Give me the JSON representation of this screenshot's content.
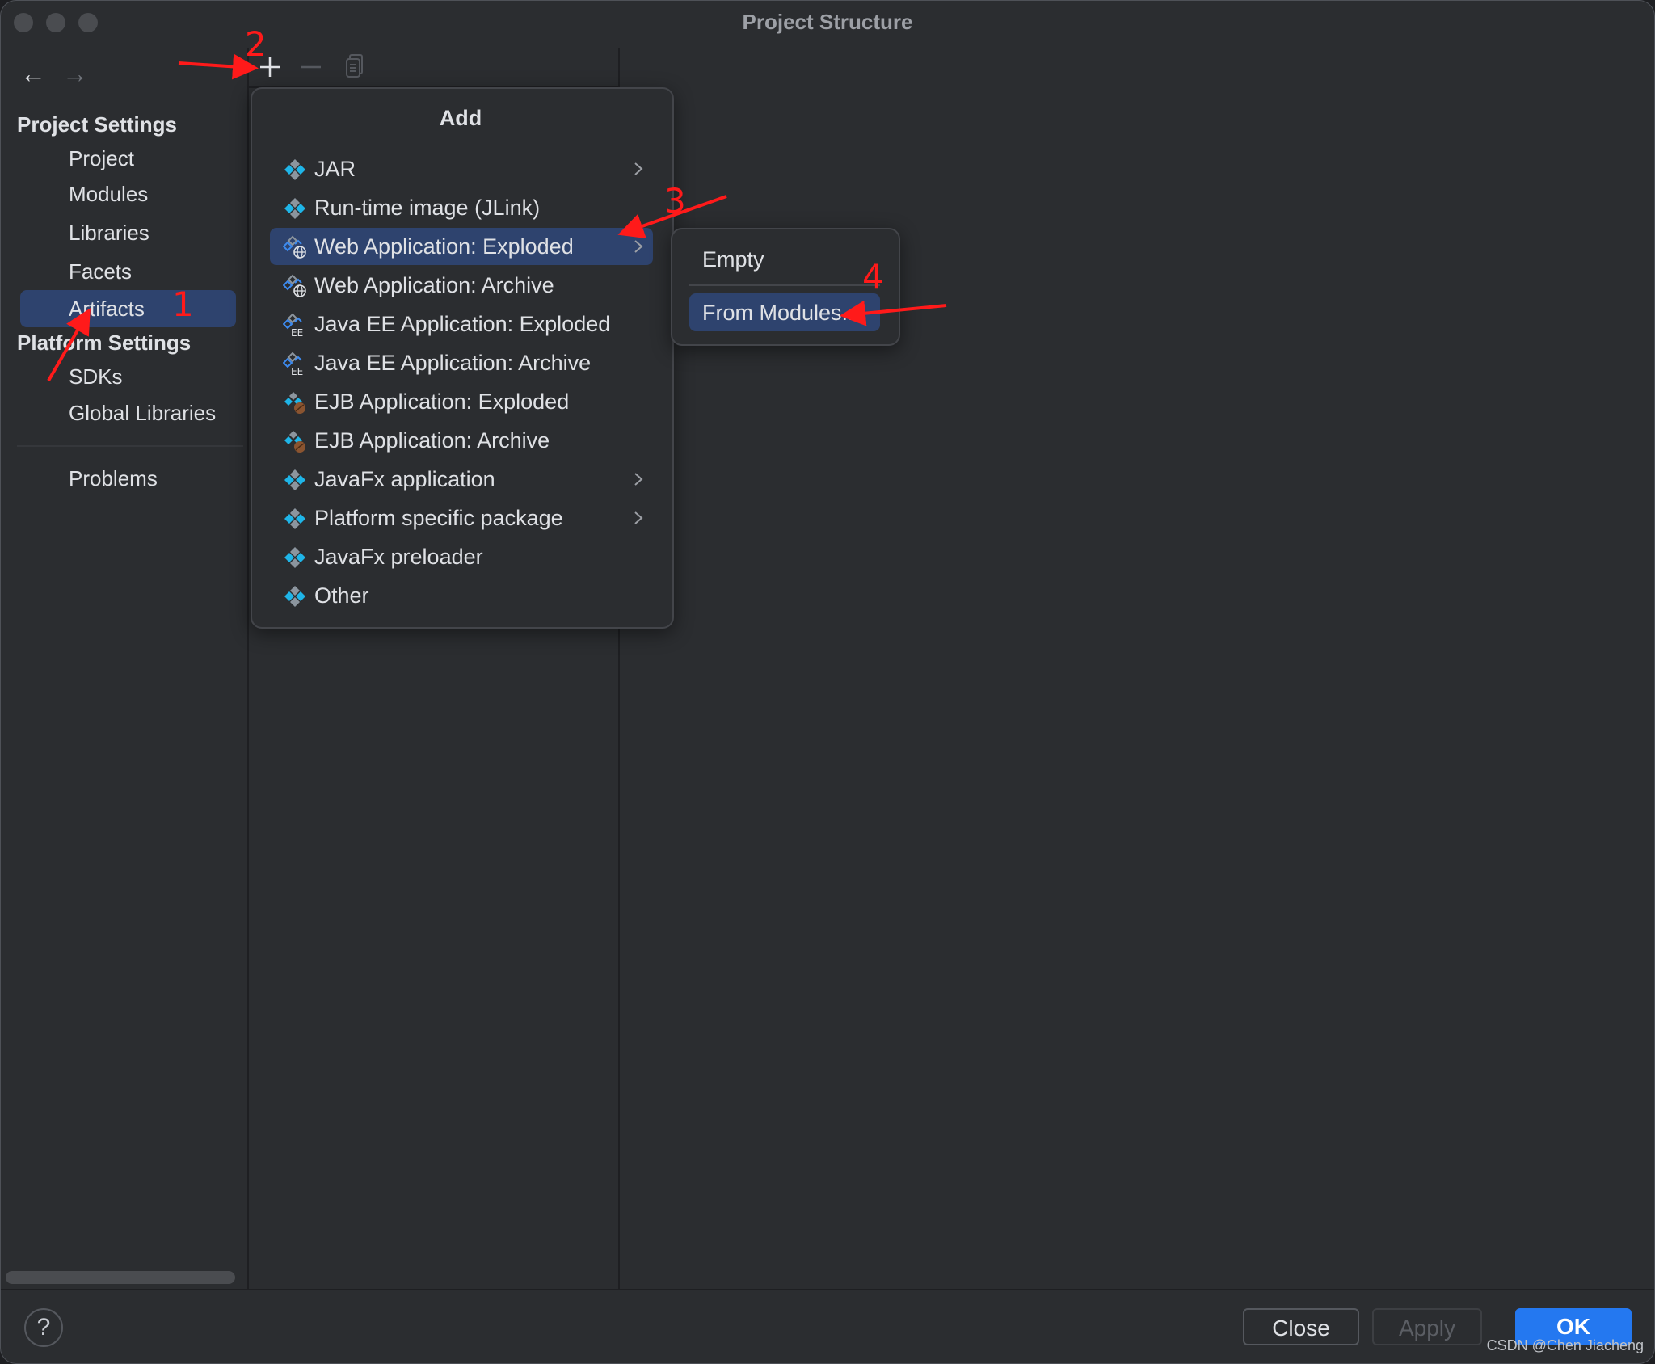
{
  "window": {
    "title": "Project Structure",
    "traffic_lights": [
      "close-button",
      "minimize-button",
      "zoom-button"
    ]
  },
  "nav": {
    "back_icon": "arrow-left-icon",
    "back_glyph": "←",
    "forward_icon": "arrow-right-icon",
    "forward_glyph": "→"
  },
  "toolbar": {
    "add_icon": "plus-icon",
    "remove_icon": "minus-icon",
    "copy_icon": "copy-icon"
  },
  "sidebar": {
    "project_settings_heading": "Project Settings",
    "project_settings_items": [
      {
        "label": "Project",
        "selected": false
      },
      {
        "label": "Modules",
        "selected": false
      },
      {
        "label": "Libraries",
        "selected": false
      },
      {
        "label": "Facets",
        "selected": false
      },
      {
        "label": "Artifacts",
        "selected": true
      }
    ],
    "platform_settings_heading": "Platform Settings",
    "platform_settings_items": [
      {
        "label": "SDKs"
      },
      {
        "label": "Global Libraries"
      }
    ],
    "problems_label": "Problems"
  },
  "add_menu": {
    "title": "Add",
    "items": [
      {
        "label": "JAR",
        "icon": "artifact-icon",
        "has_submenu": true,
        "highlighted": false
      },
      {
        "label": "Run-time image (JLink)",
        "icon": "artifact-icon",
        "has_submenu": false,
        "highlighted": false
      },
      {
        "label": "Web Application: Exploded",
        "icon": "web-artifact-icon",
        "has_submenu": true,
        "highlighted": true
      },
      {
        "label": "Web Application: Archive",
        "icon": "web-artifact-icon",
        "has_submenu": false,
        "highlighted": false
      },
      {
        "label": "Java EE Application: Exploded",
        "icon": "javaee-artifact-icon",
        "has_submenu": false,
        "highlighted": false
      },
      {
        "label": "Java EE Application: Archive",
        "icon": "javaee-artifact-icon",
        "has_submenu": false,
        "highlighted": false
      },
      {
        "label": "EJB Application: Exploded",
        "icon": "ejb-artifact-icon",
        "has_submenu": false,
        "highlighted": false
      },
      {
        "label": "EJB Application: Archive",
        "icon": "ejb-artifact-icon",
        "has_submenu": false,
        "highlighted": false
      },
      {
        "label": "JavaFx application",
        "icon": "artifact-icon",
        "has_submenu": true,
        "highlighted": false
      },
      {
        "label": "Platform specific package",
        "icon": "artifact-icon",
        "has_submenu": true,
        "highlighted": false
      },
      {
        "label": "JavaFx preloader",
        "icon": "artifact-icon",
        "has_submenu": false,
        "highlighted": false
      },
      {
        "label": "Other",
        "icon": "artifact-icon",
        "has_submenu": false,
        "highlighted": false
      }
    ]
  },
  "submenu": {
    "items": [
      {
        "label": "Empty",
        "highlighted": false
      },
      {
        "label": "From Modules...",
        "highlighted": true
      }
    ]
  },
  "footer": {
    "help_glyph": "?",
    "close_label": "Close",
    "apply_label": "Apply",
    "ok_label": "OK",
    "apply_enabled": false
  },
  "annotations": {
    "step1": "1",
    "step2": "2",
    "step3": "3",
    "step4": "4",
    "color": "#ff1a1a"
  },
  "watermark": "CSDN @Chen Jiacheng",
  "colors": {
    "background": "#2b2d30",
    "selection": "#2e436e",
    "ok_button": "#2478f0",
    "artifact_blue": "#1fb5e8",
    "artifact_gray": "#8c959e"
  }
}
